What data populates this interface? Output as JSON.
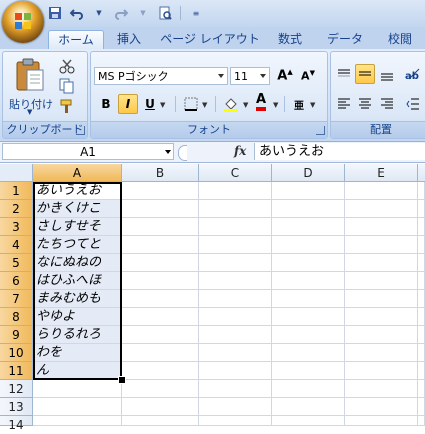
{
  "qat": {
    "icons": [
      "save-icon",
      "undo-icon",
      "redo-icon",
      "print-preview-icon",
      "customize-qat-icon"
    ]
  },
  "tabs": [
    {
      "label": "ホーム",
      "active": true
    },
    {
      "label": "挿入",
      "active": false
    },
    {
      "label": "ページ レイアウト",
      "active": false
    },
    {
      "label": "数式",
      "active": false
    },
    {
      "label": "データ",
      "active": false
    },
    {
      "label": "校閲",
      "active": false
    }
  ],
  "ribbon": {
    "clipboard": {
      "paste_label": "貼り付け",
      "group_label": "クリップボード"
    },
    "font": {
      "font_name": "MS Pゴシック",
      "font_size": "11",
      "bold": "B",
      "italic": "I",
      "underline": "U",
      "group_label": "フォント",
      "italic_active": true
    },
    "alignment": {
      "group_label": "配置"
    }
  },
  "formula_bar": {
    "name_box": "A1",
    "fx": "fx",
    "content": "あいうえお"
  },
  "grid": {
    "columns": [
      "A",
      "B",
      "C",
      "D",
      "E"
    ],
    "rows": [
      "1",
      "2",
      "3",
      "4",
      "5",
      "6",
      "7",
      "8",
      "9",
      "10",
      "11",
      "12",
      "13",
      "14"
    ],
    "selected_column": "A",
    "cells_a": [
      "あいうえお",
      "かきくけこ",
      "さしすせそ",
      "たちつてと",
      "なにぬねの",
      "はひふへほ",
      "まみむめも",
      "やゆよ",
      "らりるれろ",
      "わを",
      "ん"
    ]
  },
  "colors": {
    "accent": "#15428b",
    "selection_header": "#f1b95a",
    "grid_line": "#d0d7e5"
  }
}
